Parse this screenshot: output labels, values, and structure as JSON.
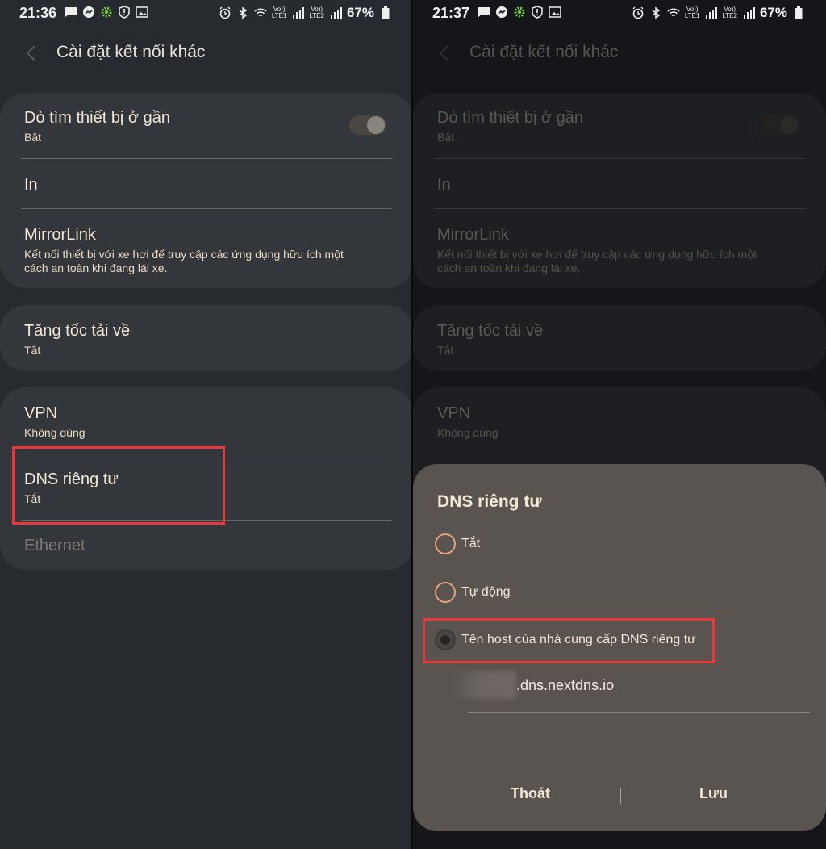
{
  "left": {
    "status": {
      "time": "21:36",
      "battery": "67%",
      "sim1": "LTE1",
      "sim2": "LTE2",
      "volte": "Vo))"
    },
    "title": "Cài đặt kết nối khác",
    "items": [
      {
        "title": "Dò tìm thiết bị ở gần",
        "sub": "Bật"
      },
      {
        "title": "In",
        "sub": ""
      },
      {
        "title": "MirrorLink",
        "sub": "Kết nối thiết bị với xe hơi để truy cập các ứng dụng hữu ích một cách an toàn khi đang lái xe."
      },
      {
        "title": "Tăng tốc tải về",
        "sub": "Tắt"
      },
      {
        "title": "VPN",
        "sub": "Không dùng"
      },
      {
        "title": "DNS riêng tư",
        "sub": "Tắt"
      },
      {
        "title": "Ethernet",
        "sub": ""
      }
    ]
  },
  "right": {
    "status": {
      "time": "21:37",
      "battery": "67%",
      "sim1": "LTE1",
      "sim2": "LTE2",
      "volte": "Vo))"
    },
    "title": "Cài đặt kết nối khác",
    "items": [
      {
        "title": "Dò tìm thiết bị ở gần",
        "sub": "Bật"
      },
      {
        "title": "In",
        "sub": ""
      },
      {
        "title": "MirrorLink",
        "sub": "Kết nối thiết bị với xe hơi để truy cập các ứng dụng hữu ích một cách an toàn khi đang lái xe."
      },
      {
        "title": "Tăng tốc tải về",
        "sub": "Tắt"
      },
      {
        "title": "VPN",
        "sub": "Không dùng"
      }
    ],
    "dialog": {
      "title": "DNS riêng tư",
      "options": [
        "Tắt",
        "Tự động",
        "Tên host của nhà cung cấp DNS riêng tư"
      ],
      "selected_index": 2,
      "hostname": ".dns.nextdns.io",
      "cancel": "Thoát",
      "save": "Lưu"
    }
  },
  "colors": {
    "highlight": "#e8383d",
    "accent_radio": "#e0a37a"
  }
}
